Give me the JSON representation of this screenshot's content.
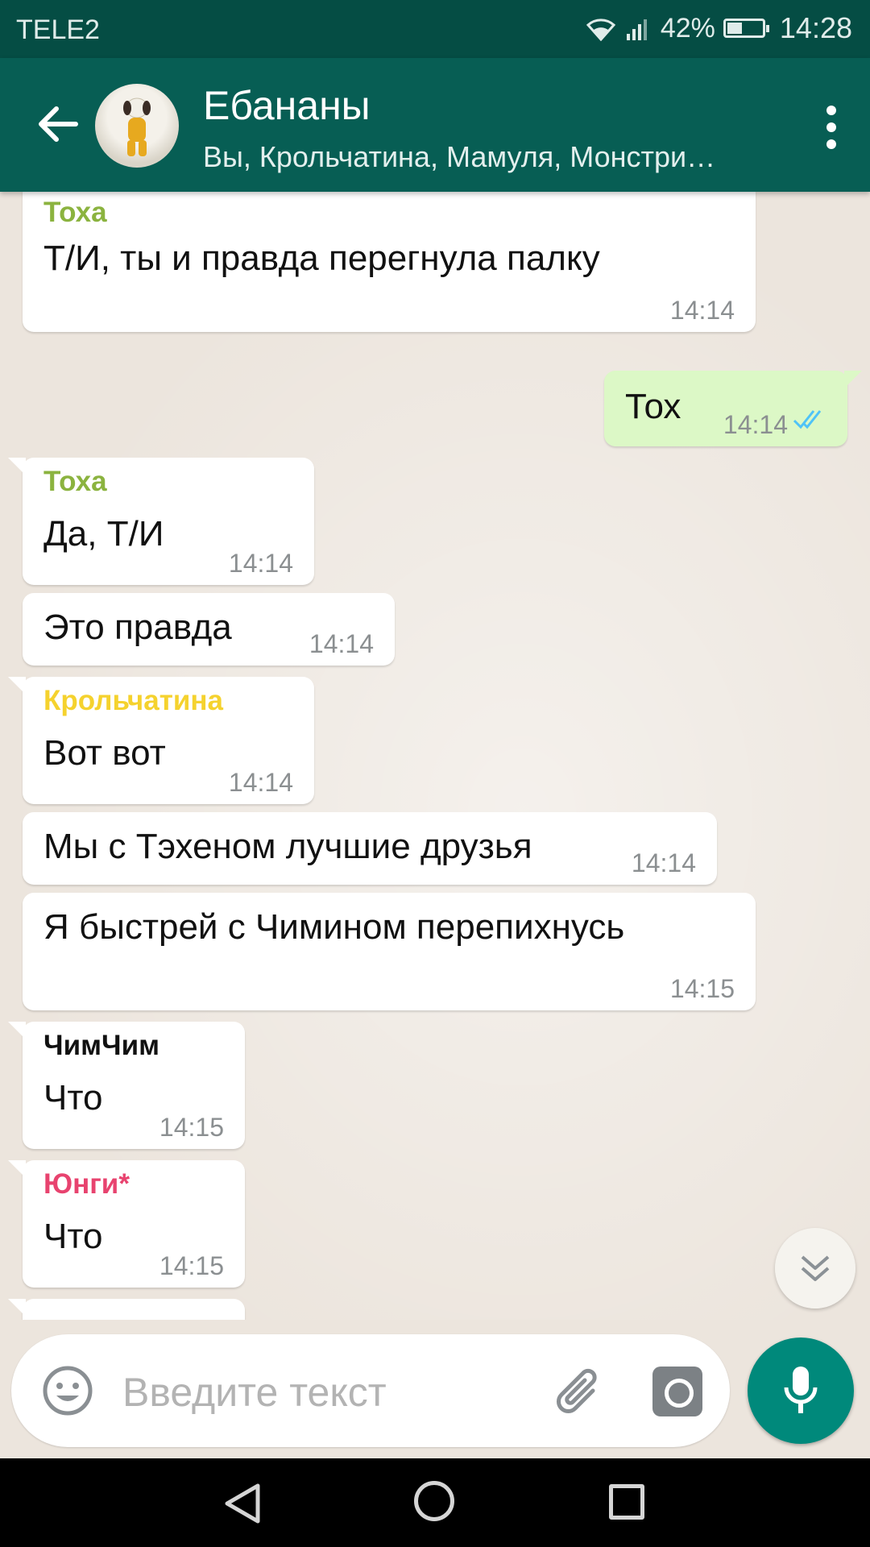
{
  "status_bar": {
    "carrier": "TELE2",
    "battery": "42%",
    "battery_level": 0.42,
    "time": "14:28"
  },
  "header": {
    "title": "Ебананы",
    "subtitle": "Вы, Крольчатина, Мамуля, Монстри…",
    "color": "#075e54"
  },
  "messages": [
    {
      "sender": "Тоха",
      "sender_color": "#8bb33f",
      "text": "Т/И, ты и правда перегнула палку",
      "time": "14:14",
      "direction": "in"
    },
    {
      "text": "Тох",
      "time": "14:14",
      "direction": "out",
      "status": "read"
    },
    {
      "sender": "Тоха",
      "sender_color": "#8bb33f",
      "text": "Да, Т/И",
      "time": "14:14",
      "direction": "in"
    },
    {
      "text": "Это правда",
      "time": "14:14",
      "direction": "in"
    },
    {
      "sender": "Крольчатина",
      "sender_color": "#f5d22e",
      "text": "Вот вот",
      "time": "14:14",
      "direction": "in"
    },
    {
      "text": "Мы с Тэхеном лучшие друзья",
      "time": "14:14",
      "direction": "in"
    },
    {
      "text": "Я быстрей с Чимином перепихнусь",
      "time": "14:15",
      "direction": "in"
    },
    {
      "sender": "ЧимЧим",
      "sender_color": "#111111",
      "text": "Что",
      "time": "14:15",
      "direction": "in"
    },
    {
      "sender": "Юнги*",
      "sender_color": "#e8436f",
      "text": "Что",
      "time": "14:15",
      "direction": "in"
    }
  ],
  "input": {
    "placeholder": "Введите текст",
    "value": ""
  },
  "icons": {
    "back": "arrow-left",
    "menu": "more-vert",
    "emoji": "smiley",
    "attach": "paperclip",
    "camera": "camera",
    "mic": "microphone",
    "scroll_down": "double-chevron-down",
    "read_ticks": "double-check-blue"
  }
}
